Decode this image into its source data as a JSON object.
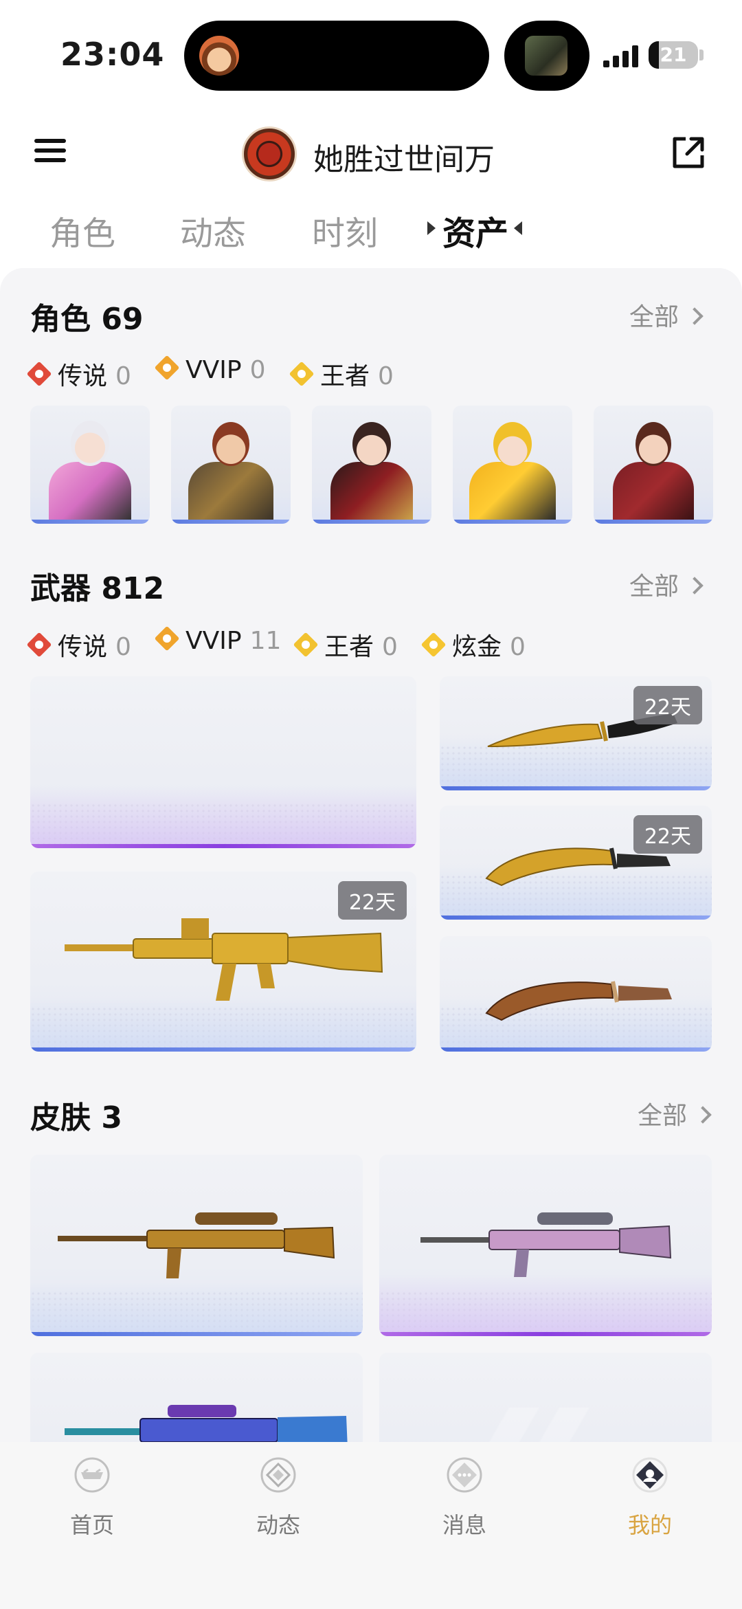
{
  "status": {
    "time": "23:04",
    "battery": "21",
    "battery_level": 0.21
  },
  "header": {
    "profile_name": "她胜过世间万"
  },
  "tabs": [
    {
      "label": "角色",
      "active": false
    },
    {
      "label": "动态",
      "active": false
    },
    {
      "label": "时刻",
      "active": false
    },
    {
      "label": "资产",
      "active": true
    }
  ],
  "sections": {
    "characters": {
      "title": "角色 69",
      "all_label": "全部",
      "rarities": [
        {
          "name": "传说",
          "count": "0",
          "color": "#e04a3a"
        },
        {
          "name": "VVIP",
          "count": "0",
          "color": "#f0a42c"
        },
        {
          "name": "王者",
          "count": "0",
          "color": "#f2c230"
        }
      ]
    },
    "weapons": {
      "title": "武器 812",
      "all_label": "全部",
      "rarities": [
        {
          "name": "传说",
          "count": "0",
          "color": "#e04a3a"
        },
        {
          "name": "VVIP",
          "count": "11",
          "color": "#f0a42c"
        },
        {
          "name": "王者",
          "count": "0",
          "color": "#f2c230"
        },
        {
          "name": "炫金",
          "count": "0",
          "color": "#f5c531"
        }
      ],
      "badges": [
        "22天",
        "22天",
        "22天"
      ]
    },
    "skins": {
      "title": "皮肤 3",
      "all_label": "全部"
    }
  },
  "bottom_nav": [
    {
      "label": "首页",
      "icon": "home-icon",
      "active": false
    },
    {
      "label": "动态",
      "icon": "feed-icon",
      "active": false
    },
    {
      "label": "消息",
      "icon": "message-icon",
      "active": false
    },
    {
      "label": "我的",
      "icon": "profile-icon",
      "active": true
    }
  ],
  "colors": {
    "accent": "#d9a441",
    "legend": "#e04a3a",
    "vvip": "#f0a42c",
    "king": "#f2c230"
  }
}
